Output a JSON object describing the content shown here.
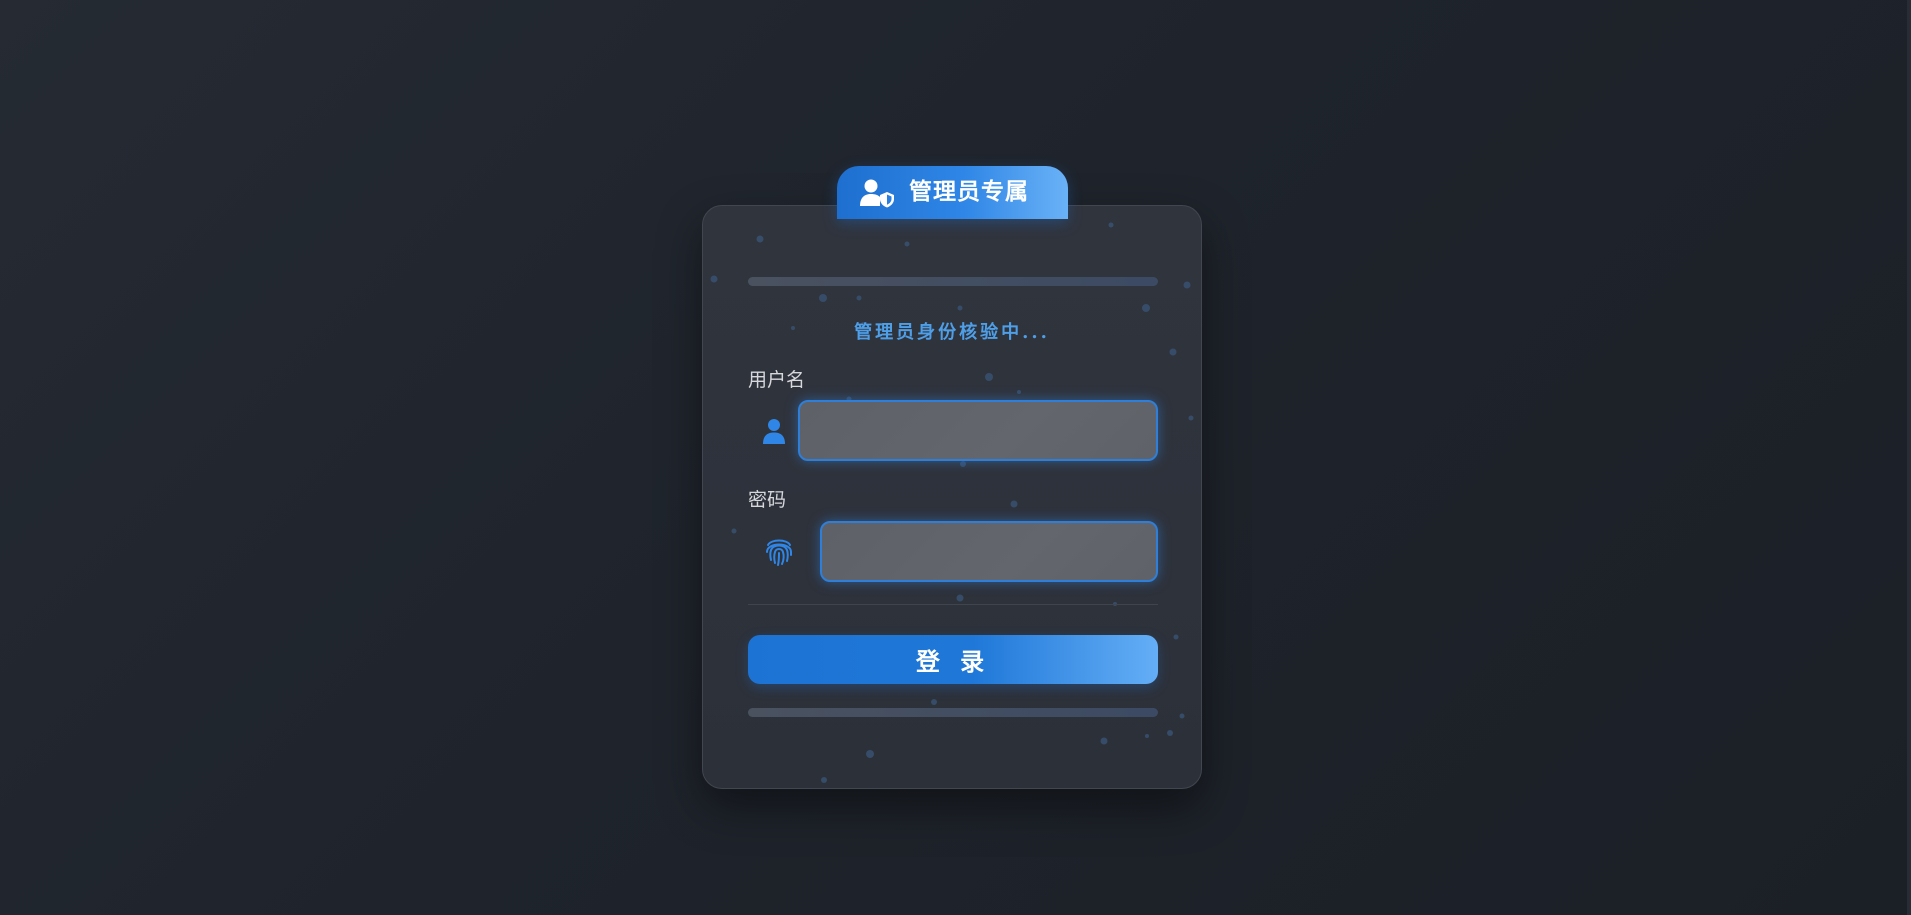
{
  "header": {
    "title": "管理员专属",
    "icon": "user-shield-icon"
  },
  "card": {
    "status_text": "管理员身份核验中...",
    "username": {
      "label": "用户名",
      "icon": "user-icon",
      "value": ""
    },
    "password": {
      "label": "密码",
      "icon": "fingerprint-icon",
      "value": ""
    },
    "login_button": "登 录"
  },
  "colors": {
    "accent": "#1e78d8",
    "accent_light": "#64aef6",
    "status_text": "#4e9fe8",
    "background": "#1f242c",
    "card": "#2e323b"
  }
}
